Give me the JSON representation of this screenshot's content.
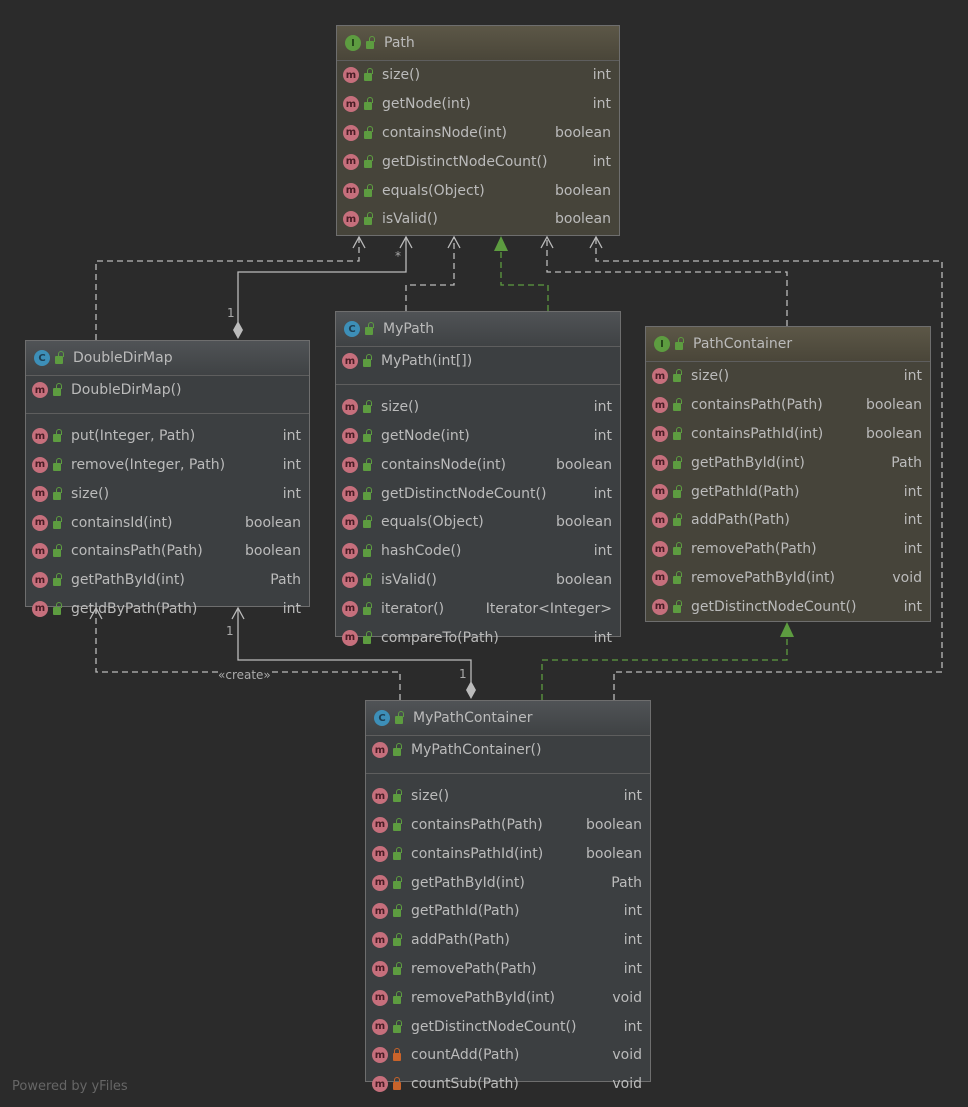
{
  "colors": {
    "background": "#2b2b2b",
    "text": "#bbbbbb",
    "realization": "#5d9c40",
    "edge": "#bbbbbb",
    "public": "#5d9c40",
    "private": "#c8632a"
  },
  "nodes": {
    "path": {
      "title": "Path",
      "kind": "interface",
      "kind_letter": "I",
      "ctors": [],
      "methods": [
        {
          "name": "size()",
          "type": "int",
          "vis": "public"
        },
        {
          "name": "getNode(int)",
          "type": "int",
          "vis": "public"
        },
        {
          "name": "containsNode(int)",
          "type": "boolean",
          "vis": "public"
        },
        {
          "name": "getDistinctNodeCount()",
          "type": "int",
          "vis": "public"
        },
        {
          "name": "equals(Object)",
          "type": "boolean",
          "vis": "public"
        },
        {
          "name": "isValid()",
          "type": "boolean",
          "vis": "public"
        }
      ]
    },
    "doubledirmap": {
      "title": "DoubleDirMap",
      "kind": "class",
      "kind_letter": "C",
      "ctors": [
        {
          "name": "DoubleDirMap()",
          "type": "",
          "vis": "public"
        }
      ],
      "methods": [
        {
          "name": "put(Integer, Path)",
          "type": "int",
          "vis": "public"
        },
        {
          "name": "remove(Integer, Path)",
          "type": "int",
          "vis": "public"
        },
        {
          "name": "size()",
          "type": "int",
          "vis": "public"
        },
        {
          "name": "containsId(int)",
          "type": "boolean",
          "vis": "public"
        },
        {
          "name": "containsPath(Path)",
          "type": "boolean",
          "vis": "public"
        },
        {
          "name": "getPathById(int)",
          "type": "Path",
          "vis": "public"
        },
        {
          "name": "getIdByPath(Path)",
          "type": "int",
          "vis": "public"
        }
      ]
    },
    "mypath": {
      "title": "MyPath",
      "kind": "class",
      "kind_letter": "C",
      "ctors": [
        {
          "name": "MyPath(int[])",
          "type": "",
          "vis": "public"
        }
      ],
      "methods": [
        {
          "name": "size()",
          "type": "int",
          "vis": "public"
        },
        {
          "name": "getNode(int)",
          "type": "int",
          "vis": "public"
        },
        {
          "name": "containsNode(int)",
          "type": "boolean",
          "vis": "public"
        },
        {
          "name": "getDistinctNodeCount()",
          "type": "int",
          "vis": "public"
        },
        {
          "name": "equals(Object)",
          "type": "boolean",
          "vis": "public"
        },
        {
          "name": "hashCode()",
          "type": "int",
          "vis": "public"
        },
        {
          "name": "isValid()",
          "type": "boolean",
          "vis": "public"
        },
        {
          "name": "iterator()",
          "type": "Iterator<Integer>",
          "vis": "public"
        },
        {
          "name": "compareTo(Path)",
          "type": "int",
          "vis": "public"
        }
      ]
    },
    "pathcontainer": {
      "title": "PathContainer",
      "kind": "interface",
      "kind_letter": "I",
      "ctors": [],
      "methods": [
        {
          "name": "size()",
          "type": "int",
          "vis": "public"
        },
        {
          "name": "containsPath(Path)",
          "type": "boolean",
          "vis": "public"
        },
        {
          "name": "containsPathId(int)",
          "type": "boolean",
          "vis": "public"
        },
        {
          "name": "getPathById(int)",
          "type": "Path",
          "vis": "public"
        },
        {
          "name": "getPathId(Path)",
          "type": "int",
          "vis": "public"
        },
        {
          "name": "addPath(Path)",
          "type": "int",
          "vis": "public"
        },
        {
          "name": "removePath(Path)",
          "type": "int",
          "vis": "public"
        },
        {
          "name": "removePathById(int)",
          "type": "void",
          "vis": "public"
        },
        {
          "name": "getDistinctNodeCount()",
          "type": "int",
          "vis": "public"
        }
      ]
    },
    "mypathcontainer": {
      "title": "MyPathContainer",
      "kind": "class",
      "kind_letter": "C",
      "ctors": [
        {
          "name": "MyPathContainer()",
          "type": "",
          "vis": "public"
        }
      ],
      "methods": [
        {
          "name": "size()",
          "type": "int",
          "vis": "public"
        },
        {
          "name": "containsPath(Path)",
          "type": "boolean",
          "vis": "public"
        },
        {
          "name": "containsPathId(int)",
          "type": "boolean",
          "vis": "public"
        },
        {
          "name": "getPathById(int)",
          "type": "Path",
          "vis": "public"
        },
        {
          "name": "getPathId(Path)",
          "type": "int",
          "vis": "public"
        },
        {
          "name": "addPath(Path)",
          "type": "int",
          "vis": "public"
        },
        {
          "name": "removePath(Path)",
          "type": "int",
          "vis": "public"
        },
        {
          "name": "removePathById(int)",
          "type": "void",
          "vis": "public"
        },
        {
          "name": "getDistinctNodeCount()",
          "type": "int",
          "vis": "public"
        },
        {
          "name": "countAdd(Path)",
          "type": "void",
          "vis": "private"
        },
        {
          "name": "countSub(Path)",
          "type": "void",
          "vis": "private"
        }
      ]
    }
  },
  "edges": [
    {
      "from": "DoubleDirMap",
      "to": "Path",
      "kind": "dependency"
    },
    {
      "from": "DoubleDirMap",
      "to": "Path",
      "kind": "aggregation",
      "source_multiplicity": "1",
      "target_multiplicity": "*"
    },
    {
      "from": "MyPath",
      "to": "Path",
      "kind": "dependency"
    },
    {
      "from": "MyPath",
      "to": "Path",
      "kind": "realization"
    },
    {
      "from": "PathContainer",
      "to": "Path",
      "kind": "dependency"
    },
    {
      "from": "MyPathContainer",
      "to": "Path",
      "kind": "dependency"
    },
    {
      "from": "MyPathContainer",
      "to": "PathContainer",
      "kind": "realization"
    },
    {
      "from": "MyPathContainer",
      "to": "DoubleDirMap",
      "kind": "composition",
      "source_multiplicity": "1",
      "target_multiplicity": "1"
    },
    {
      "from": "MyPathContainer",
      "to": "DoubleDirMap",
      "kind": "dependency",
      "label": "«create»"
    }
  ],
  "footer": "Powered by yFiles"
}
